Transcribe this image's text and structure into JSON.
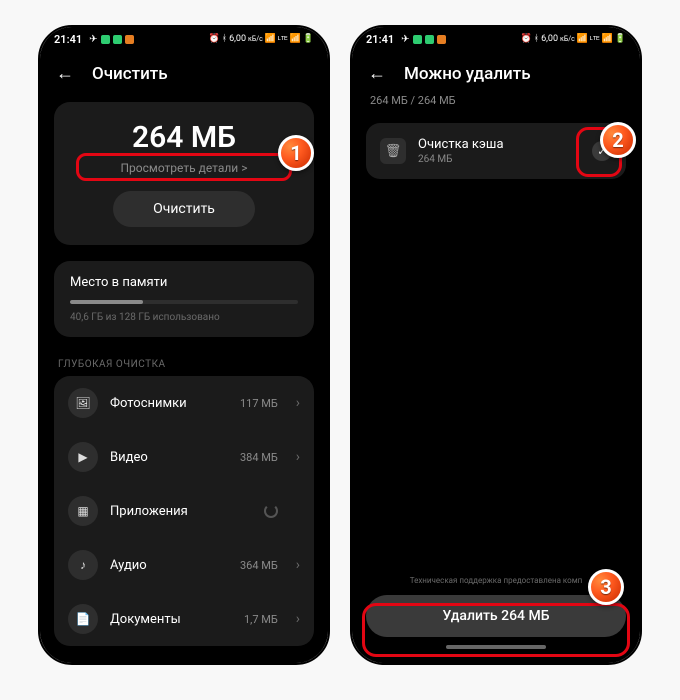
{
  "status": {
    "time": "21:41",
    "net_text": "6,00",
    "net_unit": "кБ/с"
  },
  "screen1": {
    "title": "Очистить",
    "size": "264 МБ",
    "details": "Просмотреть детали >",
    "clean_btn": "Очистить",
    "memory_title": "Место в памяти",
    "memory_sub": "40,6 ГБ из 128 ГБ использовано",
    "section": "ГЛУБОКАЯ ОЧИСТКА",
    "items": [
      {
        "icon": "photo",
        "label": "Фотоснимки",
        "value": "117 МБ"
      },
      {
        "icon": "video",
        "label": "Видео",
        "value": "384 МБ"
      },
      {
        "icon": "apps",
        "label": "Приложения",
        "value": ""
      },
      {
        "icon": "audio",
        "label": "Аудио",
        "value": "364 МБ"
      },
      {
        "icon": "docs",
        "label": "Документы",
        "value": "1,7 МБ"
      }
    ]
  },
  "screen2": {
    "title": "Можно удалить",
    "subheader": "264 МБ / 264 МБ",
    "cache_title": "Очистка кэша",
    "cache_sub": "264 МБ",
    "tech_note": "Техническая поддержка предоставлена комп",
    "delete_btn": "Удалить 264 МБ"
  },
  "badges": {
    "b1": "1",
    "b2": "2",
    "b3": "3"
  }
}
